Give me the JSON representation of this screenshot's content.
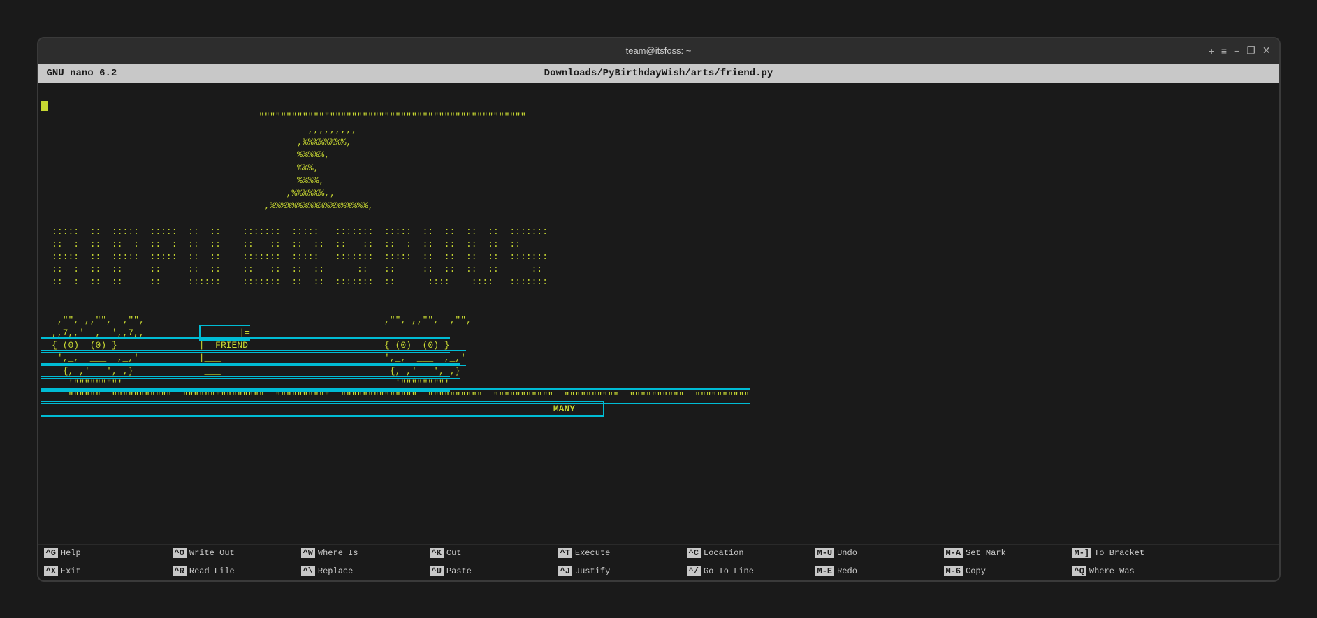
{
  "titlebar": {
    "title": "team@itsfoss: ~",
    "controls": [
      "+",
      "—",
      "❐",
      "✕"
    ]
  },
  "nano_header": {
    "left": "GNU nano 6.2",
    "center": "Downloads/PyBirthdayWish/arts/friend.py"
  },
  "ascii_art": {
    "cake_lines": [
      "                                         \"\"\"\"\"\"\"\"\"\"\"\"\"\"\"\"\"\"\"\"\"\"\"\"\"\"\"\"\"\"\"\"\"\"\"\"\"\"\"\"\"\"\"\"\"",
      "                                                  ,,,,,,,,,",
      "                                                ,%%%%%%%%,",
      "                                                %%%%%,",
      "                                                %%%,",
      "                                                %%%%,",
      "                                              ,%%%%%%,,",
      "                                          ,%%%%%%%%%%%%%%%%%%,"
    ],
    "happy_birthday": [
      "",
      "   :::::::   :::  :::::::   :::::::   :::  :::     :::::::   :::::::   :::::::  :::::::   :::  :::  :::  :::  :::  :::::::",
      "   :::  :::  :::  :::  :::  :::  :::  :::  :::     :::  :::  :::  :::  :::      :::  :::  :::  :::  :::  :::  :::  :::    ",
      "   :::::::   :::  :::::::   :::::::   :::  :::     :::::::   :::::::   ::::::   :::::::   :::  :::  :::  :::  :::  :::::::",
      "   :::  :::  :::  :::       :::       :::  :::     :::  :::  :::  :::      :::  :::       :::  :::  :::  :::  :::      :::",
      "   :::  :::  :::  :::       :::       :::::::      :::::::   :::  :::  ::::::   :::        ::::::    ::::::   :::  :::::::"
    ],
    "friend_box_lines": [
      "  ,,,,,  ,\"\",,  ,\"\",,",
      " ,,7,,,  ,,,  ,,,  ,7,",
      " { (0)  (0) }  { (0)  (0) }",
      "  ,,,  ,,,  ,,,  ,,,",
      "   {, ,  ___  , ,}",
      "    \"\"\"\"\"\"\"\"\"\"\"\"\"\"\"\"\"",
      "     \"\"\"\"\"\"  \"\"\"\"\"\"\"\"\"  \"\"\"\"\"\"\"\"\"\"\"\"\"  \"\"\"\"\"\"\"\"\"\"  \"\"\"\"\"\"\"\"\"\"\"\"\"\"  \"\"\"\"\"\"\"\"\"\"  \"\"\"\"\"\"\"\"\"\"\"\"\"  \"\"\"\"\"\"\"\"\"\"  \"\"\"\"\"\"\"\"\"\"  \"\"\"\"\"\"\"\"\"\"  "
    ],
    "many_label": "MANY"
  },
  "footer": {
    "rows": [
      [
        {
          "key": "^G",
          "label": "Help"
        },
        {
          "key": "^O",
          "label": "Write Out"
        },
        {
          "key": "^W",
          "label": "Where Is"
        },
        {
          "key": "^K",
          "label": "Cut"
        },
        {
          "key": "^T",
          "label": "Execute"
        },
        {
          "key": "^C",
          "label": "Location"
        },
        {
          "key": "M-U",
          "label": "Undo"
        },
        {
          "key": "M-A",
          "label": "Set Mark"
        },
        {
          "key": "M-]",
          "label": "To Bracket"
        }
      ],
      [
        {
          "key": "^X",
          "label": "Exit"
        },
        {
          "key": "^R",
          "label": "Read File"
        },
        {
          "key": "^\\",
          "label": "Replace"
        },
        {
          "key": "^U",
          "label": "Paste"
        },
        {
          "key": "^J",
          "label": "Justify"
        },
        {
          "key": "^/",
          "label": "Go To Line"
        },
        {
          "key": "M-E",
          "label": "Redo"
        },
        {
          "key": "M-6",
          "label": "Copy"
        },
        {
          "key": "^Q",
          "label": "Where Was"
        }
      ]
    ]
  }
}
